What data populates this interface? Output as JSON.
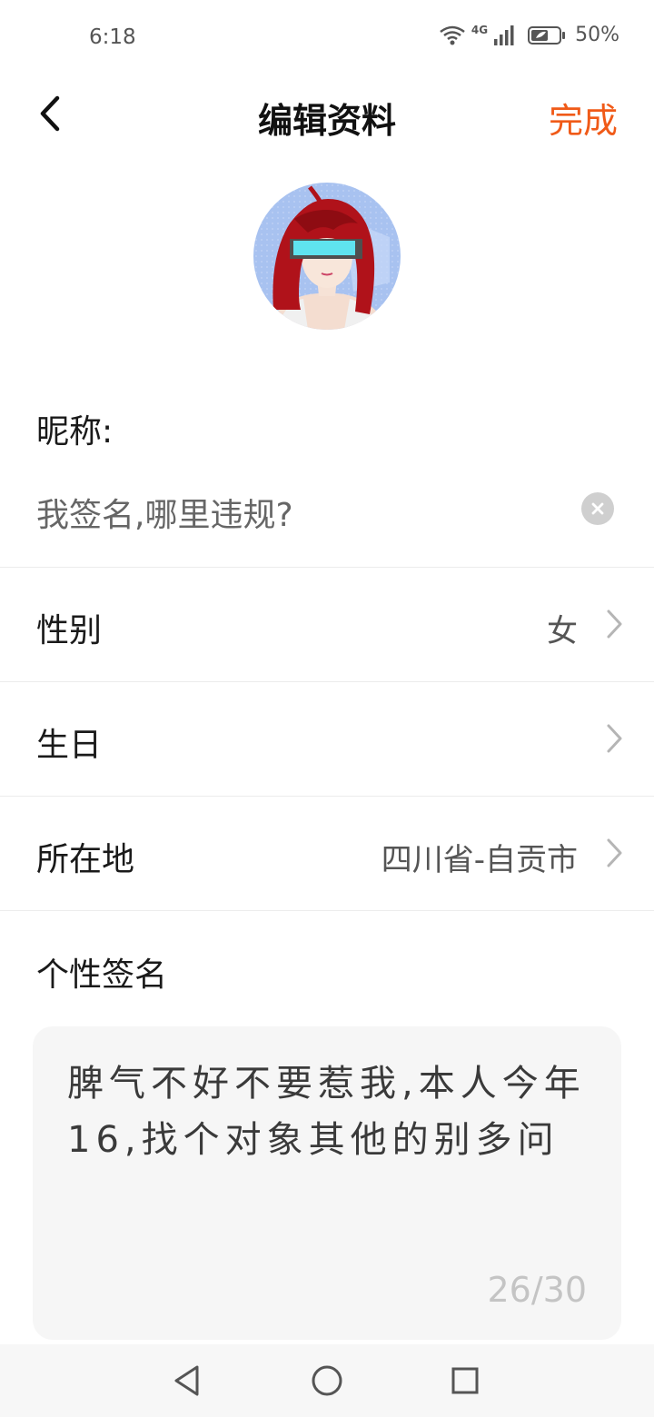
{
  "status_bar": {
    "time": "6:18",
    "network": "4G",
    "battery_percent": "50%"
  },
  "header": {
    "title": "编辑资料",
    "done_label": "完成",
    "accent_color": "#f05a18"
  },
  "profile": {
    "nickname_label": "昵称:",
    "nickname_value": "我签名,哪里违规?"
  },
  "fields": [
    {
      "label": "性别",
      "value": "女"
    },
    {
      "label": "生日",
      "value": ""
    },
    {
      "label": "所在地",
      "value": "四川省-自贡市"
    }
  ],
  "signature": {
    "label": "个性签名",
    "text": "脾气不好不要惹我,本人今年16,找个对象其他的别多问",
    "counter": "26/30"
  },
  "icons": {
    "back": "chevron-left-icon",
    "clear": "clear-icon",
    "row_arrow": "chevron-right-icon",
    "nav_back": "triangle-back-icon",
    "nav_home": "circle-home-icon",
    "nav_recent": "square-recent-icon"
  }
}
